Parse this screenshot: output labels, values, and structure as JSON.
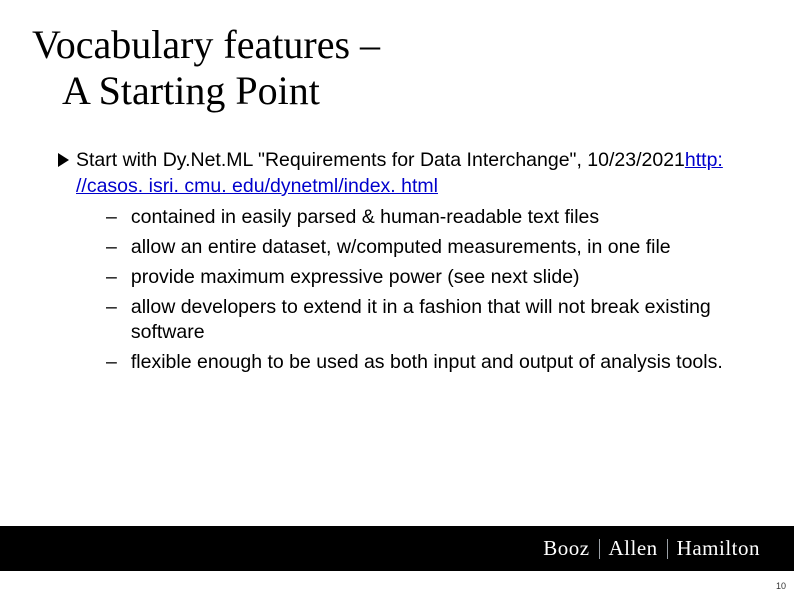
{
  "title": {
    "line1": "Vocabulary features –",
    "line2": "A Starting Point"
  },
  "bullet": {
    "lead_text": "Start with Dy.Net.ML \"Requirements for Data Interchange\", 10/23/2021",
    "link_text": "http: //casos. isri. cmu. edu/dynetml/index. html"
  },
  "sub_bullets": [
    "contained in easily parsed & human-readable text files",
    "allow an entire dataset, w/computed measurements, in one file",
    "provide maximum expressive power (see next slide)",
    "allow developers to extend it in a fashion that will not break existing software",
    "flexible enough to be used as both input and output of analysis tools."
  ],
  "footer": {
    "logo_parts": [
      "Booz",
      "Allen",
      "Hamilton"
    ]
  },
  "page_number": "10"
}
